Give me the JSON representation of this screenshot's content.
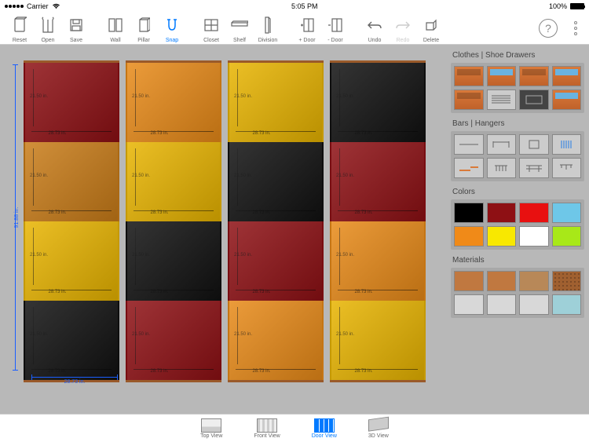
{
  "status": {
    "carrier": "Carrier",
    "time": "5:05 PM",
    "battery": "100%"
  },
  "toolbar": {
    "reset": "Reset",
    "open": "Open",
    "save": "Save",
    "wall": "Wall",
    "pillar": "Pillar",
    "snap": "Snap",
    "closet": "Closet",
    "shelf": "Shelf",
    "division": "Division",
    "plus_door": "+ Door",
    "minus_door": "- Door",
    "undo": "Undo",
    "redo": "Redo",
    "delete": "Delete"
  },
  "dims": {
    "height": "91.88 in.",
    "col_width": "28.73 in.",
    "door_w": "28.73 in.",
    "door_h": "21.50 in."
  },
  "closet": {
    "columns": [
      {
        "doors": [
          "#8e1014",
          "#c97c18",
          "#e8b400",
          "#111111"
        ]
      },
      {
        "doors": [
          "#e88a18",
          "#e8b400",
          "#111111",
          "#8e1014"
        ]
      },
      {
        "doors": [
          "#e8b400",
          "#111111",
          "#8e1014",
          "#e88a18"
        ]
      },
      {
        "doors": [
          "#111111",
          "#8e1014",
          "#e88a18",
          "#e8b400"
        ]
      }
    ]
  },
  "sidebar": {
    "clothes_title": "Clothes | Shoe Drawers",
    "bars_title": "Bars | Hangers",
    "colors_title": "Colors",
    "materials_title": "Materials",
    "colors": [
      "#000000",
      "#8e1014",
      "#e81010",
      "#6ec7e8",
      "#f08a18",
      "#f8e800",
      "#ffffff",
      "#a8e818"
    ],
    "materials": [
      "#c07840",
      "#c07840",
      "#b88858",
      "#a06030",
      "#d8d8d8",
      "#d8d8d8",
      "#d8d8d8",
      "#9ed0d8"
    ]
  },
  "views": {
    "top": "Top View",
    "front": "Front View",
    "door": "Door View",
    "threeD": "3D View"
  }
}
